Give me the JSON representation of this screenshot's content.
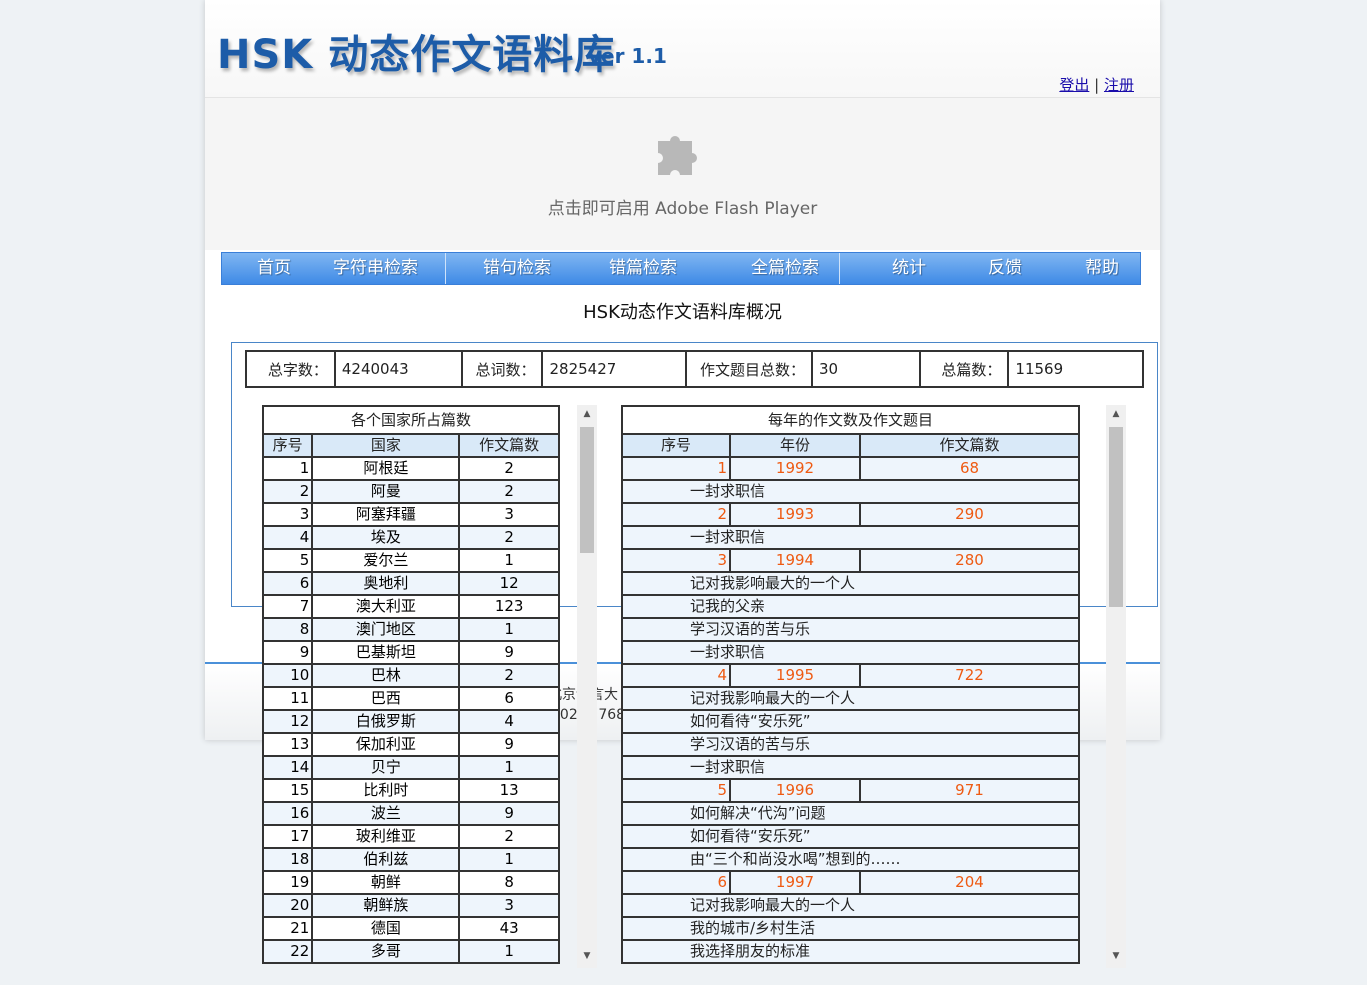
{
  "header": {
    "logo_title": "HSK 动态作文语料库",
    "logo_version": "ver 1.1",
    "logout": "登出",
    "separator": "|",
    "register": "注册"
  },
  "flash": {
    "message": "点击即可启用 Adobe Flash Player",
    "icon": "puzzle-plugin-icon"
  },
  "nav": {
    "home": "首页",
    "string_search": "字符串检索",
    "sentence_search": "错句检索",
    "essay_error_search": "错篇检索",
    "full_search": "全篇检索",
    "stats": "统计",
    "feedback": "反馈",
    "help": "帮助"
  },
  "main": {
    "title": "HSK动态作文语料库概况",
    "stats": {
      "total_chars_label": "总字数：",
      "total_chars": "4240043",
      "total_words_label": "总词数：",
      "total_words": "2825427",
      "topics_label": "作文题目总数：",
      "topics": "30",
      "total_essays_label": "总篇数：",
      "total_essays": "11569"
    }
  },
  "country_table": {
    "caption": "各个国家所占篇数",
    "headers": [
      "序号",
      "国家",
      "作文篇数"
    ],
    "rows": [
      [
        "1",
        "阿根廷",
        "2"
      ],
      [
        "2",
        "阿曼",
        "2"
      ],
      [
        "3",
        "阿塞拜疆",
        "3"
      ],
      [
        "4",
        "埃及",
        "2"
      ],
      [
        "5",
        "爱尔兰",
        "1"
      ],
      [
        "6",
        "奥地利",
        "12"
      ],
      [
        "7",
        "澳大利亚",
        "123"
      ],
      [
        "8",
        "澳门地区",
        "1"
      ],
      [
        "9",
        "巴基斯坦",
        "9"
      ],
      [
        "10",
        "巴林",
        "2"
      ],
      [
        "11",
        "巴西",
        "6"
      ],
      [
        "12",
        "白俄罗斯",
        "4"
      ],
      [
        "13",
        "保加利亚",
        "9"
      ],
      [
        "14",
        "贝宁",
        "1"
      ],
      [
        "15",
        "比利时",
        "13"
      ],
      [
        "16",
        "波兰",
        "9"
      ],
      [
        "17",
        "玻利维亚",
        "2"
      ],
      [
        "18",
        "伯利兹",
        "1"
      ],
      [
        "19",
        "朝鲜",
        "8"
      ],
      [
        "20",
        "朝鲜族",
        "3"
      ],
      [
        "21",
        "德国",
        "43"
      ],
      [
        "22",
        "多哥",
        "1"
      ]
    ]
  },
  "year_table": {
    "caption": "每年的作文数及作文题目",
    "headers": [
      "序号",
      "年份",
      "作文篇数"
    ],
    "rows": [
      {
        "type": "year",
        "no": "1",
        "year": "1992",
        "count": "68"
      },
      {
        "type": "topic",
        "text": "一封求职信"
      },
      {
        "type": "year",
        "no": "2",
        "year": "1993",
        "count": "290"
      },
      {
        "type": "topic",
        "text": "一封求职信"
      },
      {
        "type": "year",
        "no": "3",
        "year": "1994",
        "count": "280"
      },
      {
        "type": "topic",
        "text": "记对我影响最大的一个人"
      },
      {
        "type": "topic",
        "text": "记我的父亲"
      },
      {
        "type": "topic",
        "text": "学习汉语的苦与乐"
      },
      {
        "type": "topic",
        "text": "一封求职信"
      },
      {
        "type": "year",
        "no": "4",
        "year": "1995",
        "count": "722"
      },
      {
        "type": "topic",
        "text": "记对我影响最大的一个人"
      },
      {
        "type": "topic",
        "text": "如何看待“安乐死”"
      },
      {
        "type": "topic",
        "text": "学习汉语的苦与乐"
      },
      {
        "type": "topic",
        "text": "一封求职信"
      },
      {
        "type": "year",
        "no": "5",
        "year": "1996",
        "count": "971"
      },
      {
        "type": "topic",
        "text": "如何解决“代沟”问题"
      },
      {
        "type": "topic",
        "text": "如何看待“安乐死”"
      },
      {
        "type": "topic",
        "text": "由“三个和尚没水喝”想到的……"
      },
      {
        "type": "year",
        "no": "6",
        "year": "1997",
        "count": "204"
      },
      {
        "type": "topic",
        "text": "记对我影响最大的一个人"
      },
      {
        "type": "topic",
        "text": "我的城市/乡村生活"
      },
      {
        "type": "topic",
        "text": "我选择朋友的标准"
      }
    ]
  },
  "footer": {
    "contact": "联系地址：北京语言大",
    "resolution": "推荐使用1024×768"
  },
  "colors": {
    "brand_blue": "#1d5ca8",
    "nav_blue": "#3f8ae6",
    "header_row": "#d9e9f8",
    "year_accent": "#ee5a12"
  }
}
